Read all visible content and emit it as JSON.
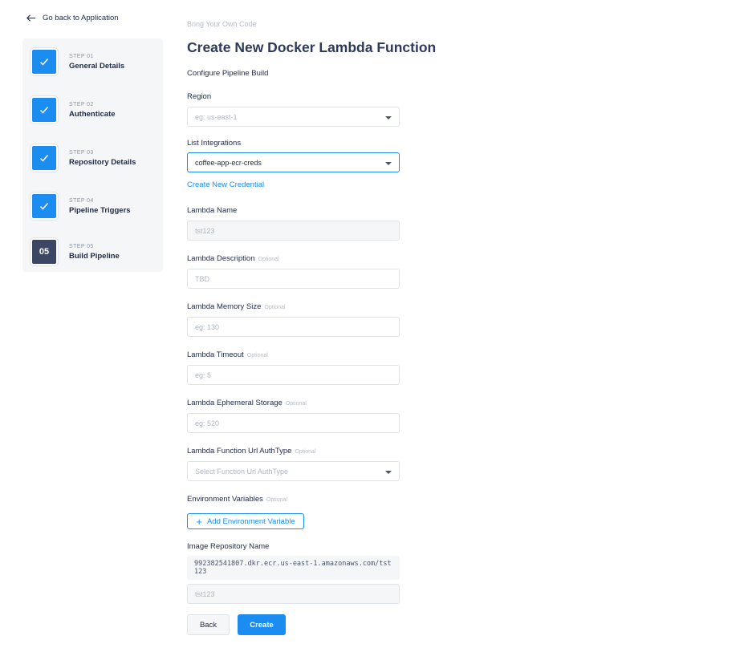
{
  "back_link": {
    "label": "Go back to Application"
  },
  "steps": [
    {
      "number": "STEP 01",
      "label": "General Details",
      "status": "done"
    },
    {
      "number": "STEP 02",
      "label": "Authenticate",
      "status": "done"
    },
    {
      "number": "STEP 03",
      "label": "Repository Details",
      "status": "done"
    },
    {
      "number": "STEP 04",
      "label": "Pipeline Triggers",
      "status": "done"
    },
    {
      "number": "STEP 05",
      "label": "Build Pipeline",
      "status": "current",
      "badge": "05"
    }
  ],
  "breadcrumb": "Bring Your Own Code",
  "title": "Create New Docker Lambda Function",
  "subtitle": "Configure Pipeline Build",
  "optional_tag": "Optional",
  "form": {
    "region": {
      "label": "Region",
      "placeholder": "eg: us-east-1"
    },
    "integrations": {
      "label": "List Integrations",
      "value": "coffee-app-ecr-creds"
    },
    "create_credential": "Create New Credential",
    "lambda_name": {
      "label": "Lambda Name",
      "value": "tst123"
    },
    "lambda_description": {
      "label": "Lambda Description",
      "placeholder": "TBD"
    },
    "memory_size": {
      "label": "Lambda Memory Size",
      "placeholder": "eg: 130"
    },
    "timeout": {
      "label": "Lambda Timeout",
      "placeholder": "eg: 5"
    },
    "ephemeral_storage": {
      "label": "Lambda Ephemeral Storage",
      "placeholder": "eg: 520"
    },
    "url_auth_type": {
      "label": "Lambda Function Url AuthType",
      "placeholder": "Select Function Url AuthType"
    },
    "env_vars": {
      "label": "Environment Variables",
      "add_button": "Add Environment Variable"
    },
    "image_repo": {
      "label": "Image Repository Name",
      "uri": "992382541807.dkr.ecr.us-east-1.amazonaws.com/tst123",
      "value": "tst123"
    }
  },
  "buttons": {
    "back": "Back",
    "create": "Create"
  },
  "colors": {
    "primary": "#1b8df0",
    "step_current": "#3c4766",
    "panel_bg": "#f5f6f8"
  }
}
